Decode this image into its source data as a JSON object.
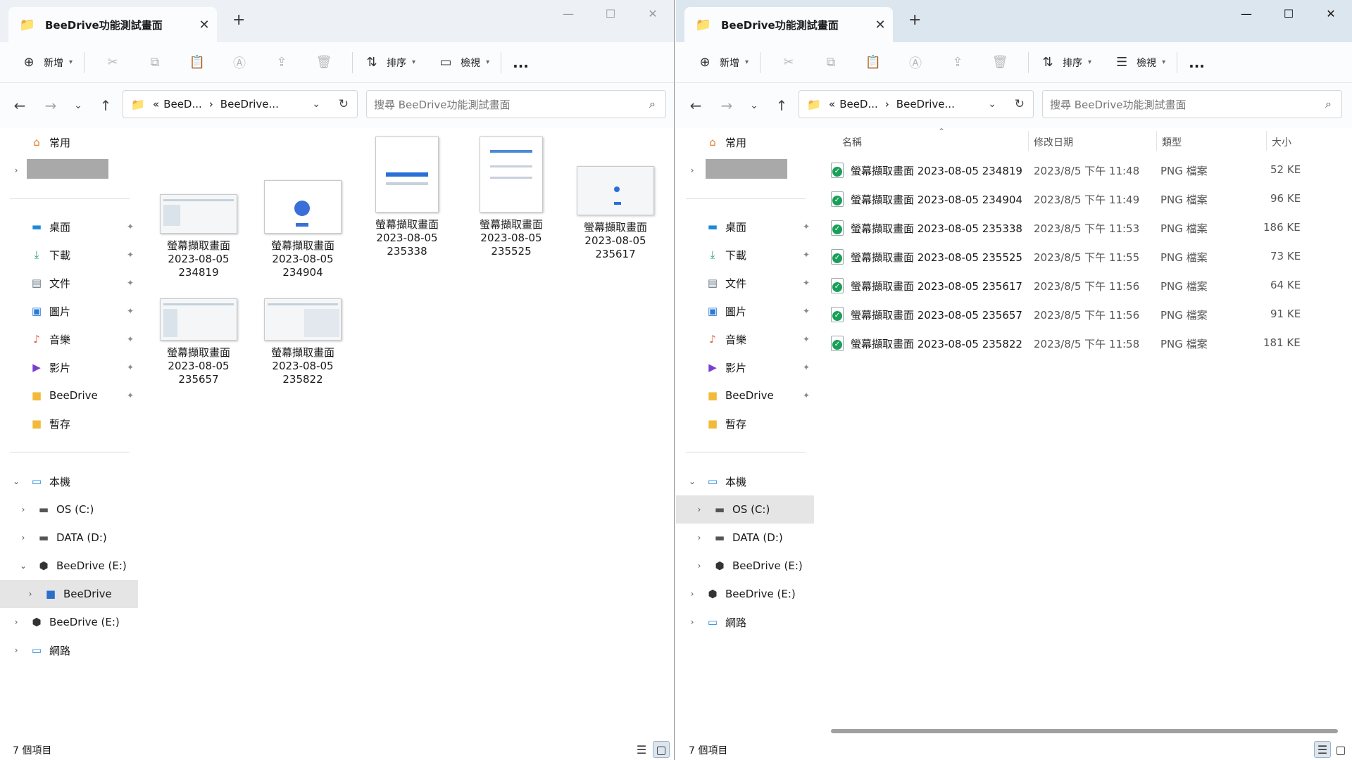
{
  "window_title": "BeeDrive功能測試畫面",
  "toolbar": {
    "new_label": "新增",
    "sort_label": "排序",
    "view_label": "檢視",
    "more_label": "..."
  },
  "address": {
    "crumb_root": "BeeD...",
    "crumb_leaf": "BeeDrive..."
  },
  "search": {
    "placeholder": "搜尋 BeeDrive功能測試畫面"
  },
  "sidebar": {
    "home": "常用",
    "quick": [
      {
        "label": "桌面",
        "icon": "desktop-icon",
        "color": "#1f8ad8"
      },
      {
        "label": "下載",
        "icon": "download-icon",
        "color": "#1a9f5a"
      },
      {
        "label": "文件",
        "icon": "document-icon",
        "color": "#6d7a86"
      },
      {
        "label": "圖片",
        "icon": "pictures-icon",
        "color": "#2a7ad8"
      },
      {
        "label": "音樂",
        "icon": "music-icon",
        "color": "#e06040"
      },
      {
        "label": "影片",
        "icon": "videos-icon",
        "color": "#7a3fd0"
      },
      {
        "label": "BeeDrive",
        "icon": "folder-icon",
        "color": "#f2b93a"
      },
      {
        "label": "暫存",
        "icon": "folder-icon",
        "color": "#f2b93a"
      }
    ],
    "this_pc": "本機",
    "drive_c": "OS (C:)",
    "drive_d": "DATA (D:)",
    "drive_e": "BeeDrive (E:)",
    "beedrive_folder": "BeeDrive",
    "network": "網路"
  },
  "files": [
    {
      "name": "螢幕擷取畫面 2023-08-05 234819",
      "line1": "螢幕擷取畫面",
      "line2": "2023-08-05",
      "line3": "234819",
      "date": "2023/8/5 下午 11:48",
      "type": "PNG 檔案",
      "size": "52 KE"
    },
    {
      "name": "螢幕擷取畫面 2023-08-05 234904",
      "line1": "螢幕擷取畫面",
      "line2": "2023-08-05",
      "line3": "234904",
      "date": "2023/8/5 下午 11:49",
      "type": "PNG 檔案",
      "size": "96 KE"
    },
    {
      "name": "螢幕擷取畫面 2023-08-05 235338",
      "line1": "螢幕擷取畫面",
      "line2": "2023-08-05",
      "line3": "235338",
      "date": "2023/8/5 下午 11:53",
      "type": "PNG 檔案",
      "size": "186 KE"
    },
    {
      "name": "螢幕擷取畫面 2023-08-05 235525",
      "line1": "螢幕擷取畫面",
      "line2": "2023-08-05",
      "line3": "235525",
      "date": "2023/8/5 下午 11:55",
      "type": "PNG 檔案",
      "size": "73 KE"
    },
    {
      "name": "螢幕擷取畫面 2023-08-05 235617",
      "line1": "螢幕擷取畫面",
      "line2": "2023-08-05",
      "line3": "235617",
      "date": "2023/8/5 下午 11:56",
      "type": "PNG 檔案",
      "size": "64 KE"
    },
    {
      "name": "螢幕擷取畫面 2023-08-05 235657",
      "line1": "螢幕擷取畫面",
      "line2": "2023-08-05",
      "line3": "235657",
      "date": "2023/8/5 下午 11:56",
      "type": "PNG 檔案",
      "size": "91 KE"
    },
    {
      "name": "螢幕擷取畫面 2023-08-05 235822",
      "line1": "螢幕擷取畫面",
      "line2": "2023-08-05",
      "line3": "235822",
      "date": "2023/8/5 下午 11:58",
      "type": "PNG 檔案",
      "size": "181 KE"
    }
  ],
  "columns": {
    "name": "名稱",
    "date": "修改日期",
    "type": "類型",
    "size": "大小"
  },
  "status": {
    "count": "7 個項目"
  }
}
